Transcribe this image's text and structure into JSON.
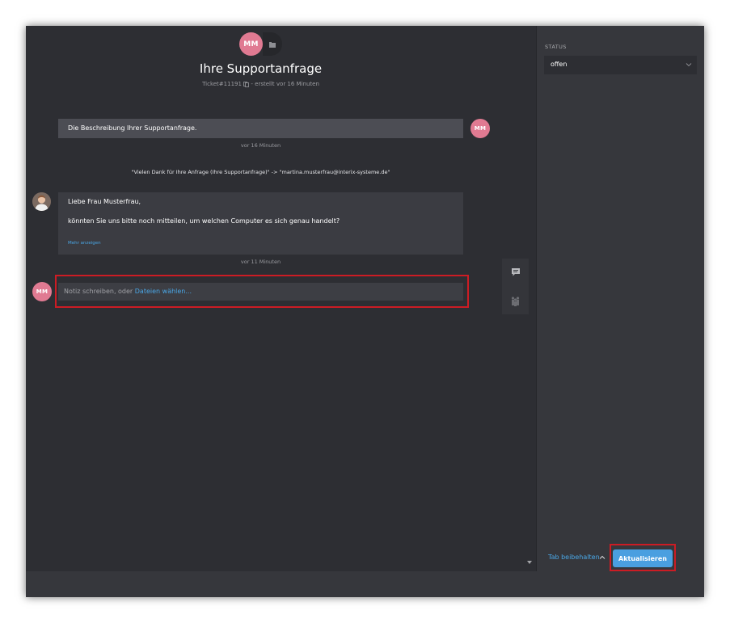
{
  "ticket": {
    "customer_initials": "MM",
    "title": "Ihre Supportanfrage",
    "number": "Ticket#11191",
    "created": "- erstellt vor 16 Minuten"
  },
  "conversation": {
    "customer_message": "Die Beschreibung Ihrer Supportanfrage.",
    "customer_message_time": "vor 16 Minuten",
    "email_info": "\"Vielen Dank für Ihre Anfrage (Ihre Supportanfrage)\" -> \"martina.musterfrau@interix-systeme.de\"",
    "agent_greeting": "Liebe Frau Musterfrau,",
    "agent_body": "könnten Sie uns bitte noch mitteilen, um welchen Computer es sich genau handelt?",
    "show_more": "Mehr anzeigen",
    "agent_message_time": "vor 11 Minuten"
  },
  "note": {
    "placeholder": "Notiz schreiben, oder ",
    "file_link": "Dateien wählen..."
  },
  "sidebar": {
    "status_label": "STATUS",
    "status_value": "offen"
  },
  "bottom_bar": {
    "tab_keep": "Tab beibehalten",
    "update_button": "Aktualisieren"
  },
  "colors": {
    "accent": "#4a9fe0",
    "avatar": "#e07a92",
    "highlight": "#cc1c24"
  }
}
